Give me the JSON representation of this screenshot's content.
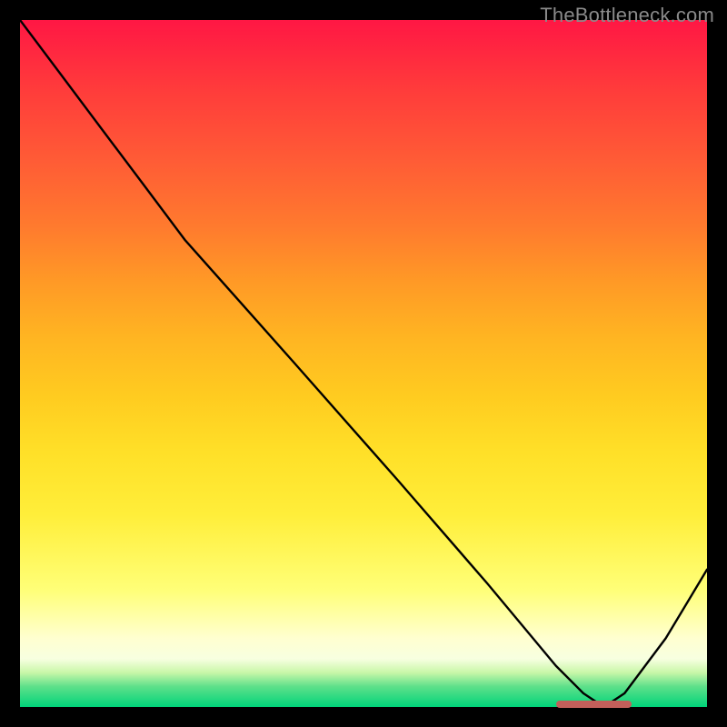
{
  "watermark": "TheBottleneck.com",
  "colors": {
    "curve_stroke": "#000000",
    "marker": "#c25f5a",
    "background": "#000000"
  },
  "chart_data": {
    "type": "line",
    "title": "",
    "xlabel": "",
    "ylabel": "",
    "xlim": [
      0,
      100
    ],
    "ylim": [
      0,
      100
    ],
    "grid": false,
    "legend": false,
    "series": [
      {
        "name": "bottleneck-curve",
        "x": [
          0,
          6,
          12,
          18,
          24,
          40,
          55,
          68,
          78,
          82,
          85,
          88,
          94,
          100
        ],
        "y": [
          100,
          92,
          84,
          76,
          68,
          50,
          33,
          18,
          6,
          2,
          0,
          2,
          10,
          20
        ]
      }
    ],
    "annotations": [
      {
        "name": "optimal-marker",
        "x_start": 78,
        "x_end": 89,
        "y": 0.4
      }
    ],
    "gradient_stops": [
      {
        "pos": 0.0,
        "color": "#ff1744"
      },
      {
        "pos": 0.25,
        "color": "#ff7a2e"
      },
      {
        "pos": 0.55,
        "color": "#ffcc20"
      },
      {
        "pos": 0.85,
        "color": "#ffff90"
      },
      {
        "pos": 1.0,
        "color": "#00d47a"
      }
    ]
  }
}
